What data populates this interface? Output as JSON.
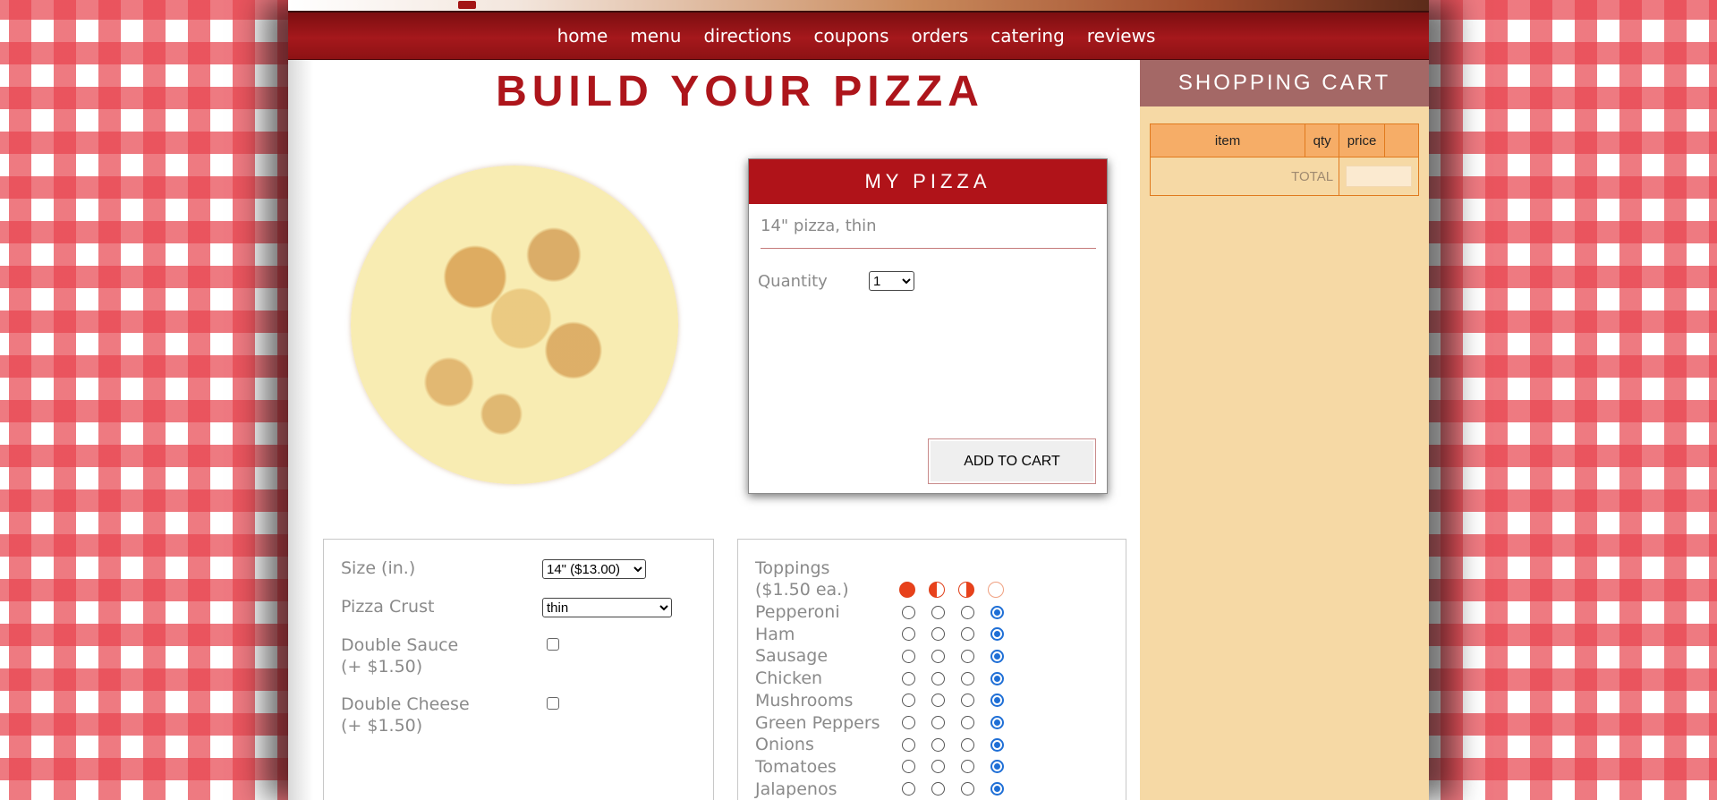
{
  "nav": [
    "home",
    "menu",
    "directions",
    "coupons",
    "orders",
    "catering",
    "reviews"
  ],
  "page_title": "BUILD YOUR PIZZA",
  "my_pizza": {
    "heading": "MY PIZZA",
    "description": "14\" pizza, thin",
    "quantity_label": "Quantity",
    "quantity_value": "1",
    "add_button": "ADD TO CART"
  },
  "options": {
    "size_label": "Size (in.)",
    "size_value": "14\" ($13.00)",
    "crust_label": "Pizza Crust",
    "crust_value": "thin",
    "double_sauce_label": "Double Sauce",
    "double_sauce_price": "(+ $1.50)",
    "double_sauce_checked": false,
    "double_cheese_label": "Double Cheese",
    "double_cheese_price": "(+ $1.50)",
    "double_cheese_checked": false
  },
  "toppings": {
    "heading": "Toppings",
    "price": "($1.50 ea.)",
    "legend_icons": [
      "whole-pizza-icon",
      "left-half-icon",
      "right-half-icon",
      "none-icon"
    ],
    "items": [
      {
        "name": "Pepperoni",
        "selected": 3
      },
      {
        "name": "Ham",
        "selected": 3
      },
      {
        "name": "Sausage",
        "selected": 3
      },
      {
        "name": "Chicken",
        "selected": 3
      },
      {
        "name": "Mushrooms",
        "selected": 3
      },
      {
        "name": "Green Peppers",
        "selected": 3
      },
      {
        "name": "Onions",
        "selected": 3
      },
      {
        "name": "Tomatoes",
        "selected": 3
      },
      {
        "name": "Jalapenos",
        "selected": 3
      }
    ]
  },
  "cart": {
    "heading": "SHOPPING CART",
    "columns": [
      "item",
      "qty",
      "price",
      ""
    ],
    "total_label": "TOTAL",
    "total_value": ""
  },
  "colors": {
    "brand_red": "#b01319",
    "cart_bg": "#f6d9a5",
    "cart_header": "#a46866",
    "table_header": "#f6ad67",
    "radio_selected": "#1f6fd6"
  }
}
